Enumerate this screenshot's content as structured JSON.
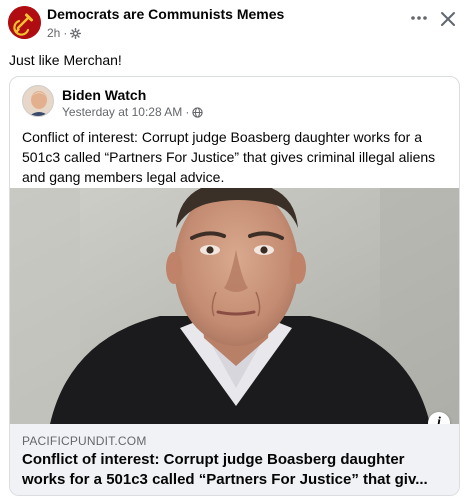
{
  "post": {
    "page_name": "Democrats are Communists Memes",
    "time": "2h",
    "separator": "·",
    "text": "Just like Merchan!"
  },
  "shared_post": {
    "author": "Biden Watch",
    "time": "Yesterday at 10:28 AM",
    "separator": "·",
    "text": "Conflict of interest: Corrupt judge Boasberg daughter works for a 501c3 called “Partners For Justice” that gives criminal illegal aliens and gang members legal advice."
  },
  "link_preview": {
    "domain": "PACIFICPUNDIT.COM",
    "title": "Conflict of interest: Corrupt judge Boasberg daughter works for a 501c3 called “Partners For Justice” that giv...",
    "info_glyph": "i"
  },
  "icons": {
    "more": "more-options-icon",
    "close": "close-icon",
    "privacy": "gear-icon",
    "audience": "globe-icon"
  },
  "colors": {
    "primary_text": "#050505",
    "secondary_text": "#65676b",
    "card_border": "#dadde1",
    "link_footer_bg": "#f0f2f5",
    "avatar_red": "#b00d12",
    "avatar_gold": "#f2c230"
  }
}
